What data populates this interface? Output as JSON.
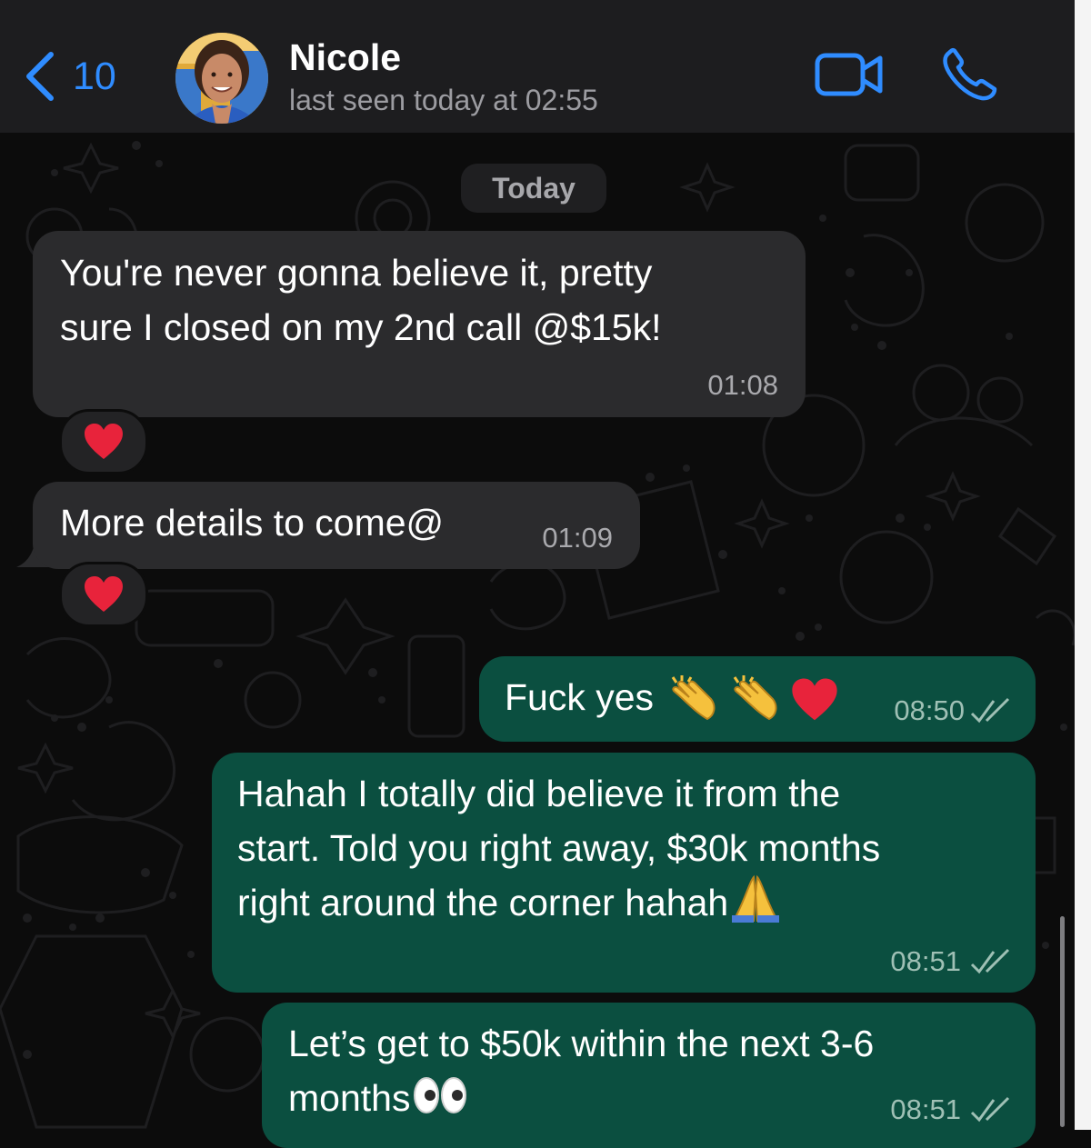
{
  "header": {
    "back_count": "10",
    "contact_name": "Nicole",
    "contact_status": "last seen today at 02:55"
  },
  "date_divider": "Today",
  "messages": [
    {
      "direction": "incoming",
      "text": "You're never gonna believe it, pretty\nsure I closed on my 2nd call @$15k!",
      "time": "01:08",
      "reaction": "red-heart"
    },
    {
      "direction": "incoming",
      "text": "More details to come@",
      "time": "01:09",
      "reaction": "red-heart"
    },
    {
      "direction": "outgoing",
      "text": "Fuck yes",
      "emoji": [
        "clapping-hands",
        "clapping-hands",
        "red-heart"
      ],
      "time": "08:50",
      "status": "read"
    },
    {
      "direction": "outgoing",
      "text": "Hahah I totally did believe it from the\nstart. Told you right away, $30k months\nright around the corner hahah",
      "emoji": [
        "folded-hands"
      ],
      "time": "08:51",
      "status": "read"
    },
    {
      "direction": "outgoing",
      "text": "Let’s get to $50k within the next 3-6\nmonths",
      "emoji": [
        "eyes"
      ],
      "time": "08:51",
      "status": "read"
    }
  ],
  "colors": {
    "accent_blue": "#2f8cff",
    "incoming_bubble": "#2b2b2d",
    "outgoing_bubble": "#0b4f40",
    "header_bg": "#1d1d1f",
    "heart_red": "#e8233b"
  }
}
